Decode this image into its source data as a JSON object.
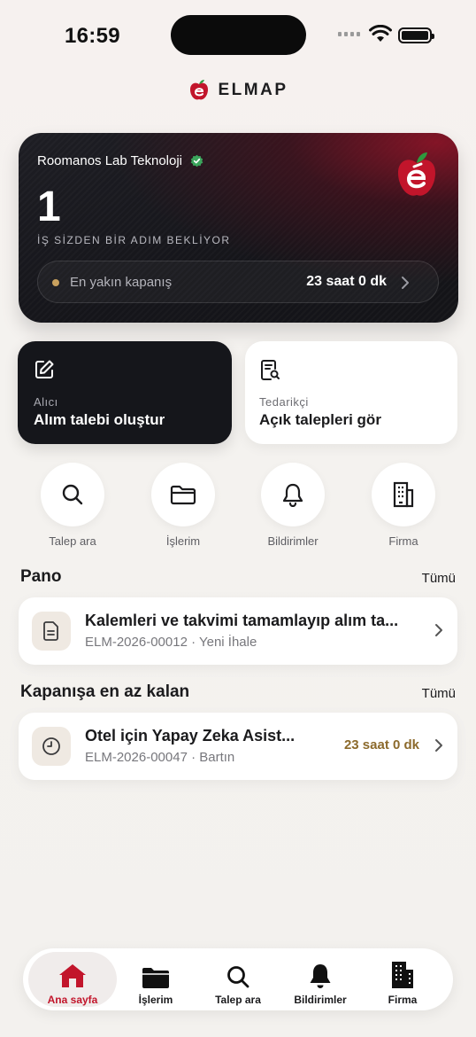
{
  "status_bar": {
    "time": "16:59"
  },
  "brand": {
    "name": "ELMAP"
  },
  "hero": {
    "company": "Roomanos Lab Teknoloji",
    "count": "1",
    "subtitle": "İŞ SİZDEN BİR ADIM BEKLİYOR",
    "deadline_label": "En yakın kapanış",
    "deadline_value": "23 saat 0 dk"
  },
  "actions": [
    {
      "role": "Alıcı",
      "title": "Alım talebi oluştur"
    },
    {
      "role": "Tedarikçi",
      "title": "Açık talepleri gör"
    }
  ],
  "quick_links": [
    {
      "label": "Talep ara",
      "icon": "search-icon"
    },
    {
      "label": "İşlerim",
      "icon": "folder-icon"
    },
    {
      "label": "Bildirimler",
      "icon": "bell-icon"
    },
    {
      "label": "Firma",
      "icon": "building-icon"
    }
  ],
  "pano": {
    "title": "Pano",
    "all_label": "Tümü",
    "item": {
      "title": "Kalemleri ve takvimi tamamlayıp alım ta...",
      "subtitle": "ELM-2026-00012 · Yeni İhale",
      "icon": "document-icon"
    }
  },
  "closing": {
    "title": "Kapanışa en az kalan",
    "all_label": "Tümü",
    "item": {
      "title": "Otel için Yapay Zeka Asist...",
      "subtitle": "ELM-2026-00047 · Bartın",
      "time": "23 saat 0 dk",
      "icon": "clock-icon"
    }
  },
  "tabbar": [
    {
      "label": "Ana sayfa",
      "icon": "home-icon",
      "active": true
    },
    {
      "label": "İşlerim",
      "icon": "folder-icon",
      "active": false
    },
    {
      "label": "Talep ara",
      "icon": "search-icon",
      "active": false
    },
    {
      "label": "Bildirimler",
      "icon": "bell-icon",
      "active": false
    },
    {
      "label": "Firma",
      "icon": "building-icon",
      "active": false
    }
  ],
  "colors": {
    "accent": "#c2152b",
    "deadline": "#8c6a2c",
    "hero_bg": "#16161b"
  }
}
